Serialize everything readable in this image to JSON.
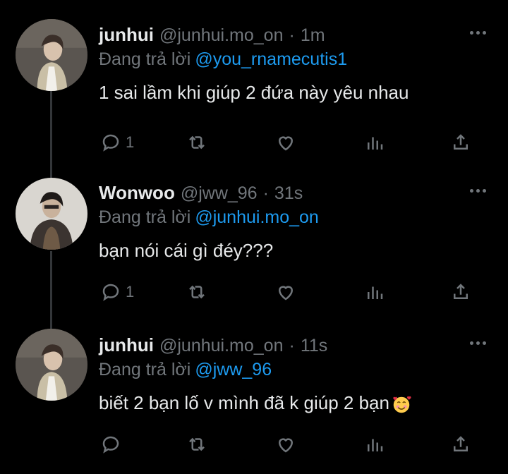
{
  "reply_prefix": "Đang trả lời",
  "tweets": [
    {
      "name": "junhui",
      "handle": "@junhui.mo_on",
      "time": "1m",
      "reply_to": "@you_rnamecutis1",
      "text": "1 sai lầm khi giúp 2 đứa này yêu nhau",
      "reply_count": "1",
      "avatar_icon": "avatar-junhui"
    },
    {
      "name": "Wonwoo",
      "handle": "@jww_96",
      "time": "31s",
      "reply_to": "@junhui.mo_on",
      "text": "bạn nói cái gì đéy???",
      "reply_count": "1",
      "avatar_icon": "avatar-wonwoo"
    },
    {
      "name": "junhui",
      "handle": "@junhui.mo_on",
      "time": "11s",
      "reply_to": "@jww_96",
      "text": "biết 2 bạn lố v mình đã k giúp 2 bạn",
      "text_emoji": "smiling-face-with-hearts",
      "reply_count": "",
      "avatar_icon": "avatar-junhui"
    }
  ],
  "colors": {
    "background": "#000000",
    "primary_text": "#e7e9ea",
    "secondary_text": "#71767b",
    "mention": "#1d9bf0",
    "thread_line": "#333639"
  }
}
